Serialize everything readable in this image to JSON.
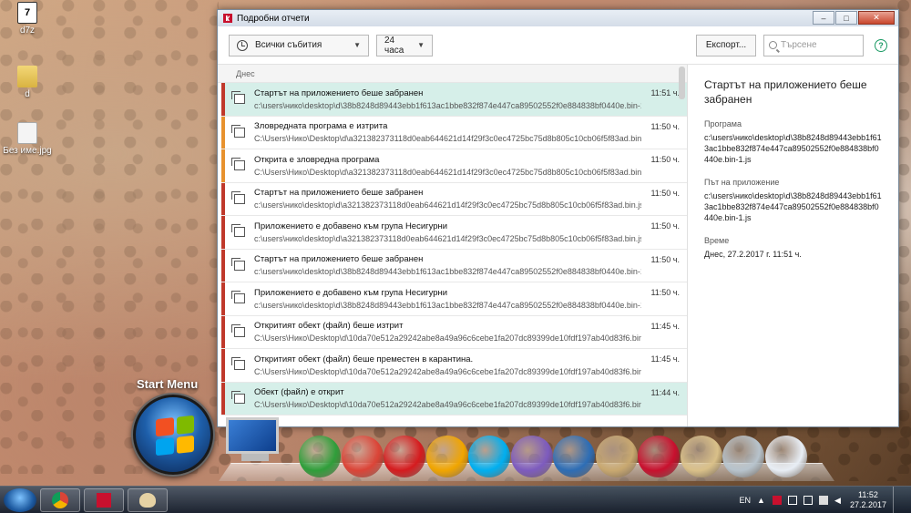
{
  "desktop": {
    "icons": [
      {
        "label": "d7z",
        "icon": "7z-archive-icon"
      },
      {
        "label": "d",
        "icon": "folder-icon"
      },
      {
        "label": "Без име.jpg",
        "icon": "image-file-icon"
      }
    ]
  },
  "window": {
    "title": "Подробни отчети",
    "controls": {
      "minimize": "‒",
      "maximize": "□",
      "close": "✕"
    }
  },
  "toolbar": {
    "events_filter": "Всички събития",
    "time_filter": "24 часа",
    "export_label": "Експорт...",
    "search_placeholder": "Търсене",
    "help_label": "?"
  },
  "list": {
    "group_label": "Днес",
    "rows": [
      {
        "title": "Стартът на приложението беше забранен",
        "path": "c:\\users\\нико\\desktop\\d\\38b8248d89443ebb1f613ac1bbe832f874e447ca89502552f0e884838bf0440e.bin-1.js",
        "time": "11:51 ч.",
        "severity_color": "#c0392b",
        "selected": true
      },
      {
        "title": "Зловредната програма е изтрита",
        "path": "C:\\Users\\Нико\\Desktop\\d\\a321382373118d0eab644621d14f29f3c0ec4725bc75d8b805c10cb06f5f83ad.bin.js",
        "time": "11:50 ч.",
        "severity_color": "#e8922e",
        "selected": false
      },
      {
        "title": "Открита е зловредна програма",
        "path": "C:\\Users\\Нико\\Desktop\\d\\a321382373118d0eab644621d14f29f3c0ec4725bc75d8b805c10cb06f5f83ad.bin.js",
        "time": "11:50 ч.",
        "severity_color": "#e8922e",
        "selected": false
      },
      {
        "title": "Стартът на приложението беше забранен",
        "path": "c:\\users\\нико\\desktop\\d\\a321382373118d0eab644621d14f29f3c0ec4725bc75d8b805c10cb06f5f83ad.bin.js",
        "time": "11:50 ч.",
        "severity_color": "#c0392b",
        "selected": false
      },
      {
        "title": "Приложението е добавено към група Несигурни",
        "path": "c:\\users\\нико\\desktop\\d\\a321382373118d0eab644621d14f29f3c0ec4725bc75d8b805c10cb06f5f83ad.bin.js",
        "time": "11:50 ч.",
        "severity_color": "#c0392b",
        "selected": false
      },
      {
        "title": "Стартът на приложението беше забранен",
        "path": "c:\\users\\нико\\desktop\\d\\38b8248d89443ebb1f613ac1bbe832f874e447ca89502552f0e884838bf0440e.bin-1.js",
        "time": "11:50 ч.",
        "severity_color": "#c0392b",
        "selected": false
      },
      {
        "title": "Приложението е добавено към група Несигурни",
        "path": "c:\\users\\нико\\desktop\\d\\38b8248d89443ebb1f613ac1bbe832f874e447ca89502552f0e884838bf0440e.bin-1.js",
        "time": "11:50 ч.",
        "severity_color": "#c0392b",
        "selected": false
      },
      {
        "title": "Откритият обект (файл) беше изтрит",
        "path": "C:\\Users\\Нико\\Desktop\\d\\10da70e512a29242abe8a49a96c6cebe1fa207dc89399de10fdf197ab40d83f6.bin.js",
        "time": "11:45 ч.",
        "severity_color": "#c0392b",
        "selected": false
      },
      {
        "title": "Откритият обект (файл) беше преместен в карантина.",
        "path": "C:\\Users\\Нико\\Desktop\\d\\10da70e512a29242abe8a49a96c6cebe1fa207dc89399de10fdf197ab40d83f6.bin.js",
        "time": "11:45 ч.",
        "severity_color": "#c0392b",
        "selected": false
      },
      {
        "title": "Обект (файл) е открит",
        "path": "C:\\Users\\Нико\\Desktop\\d\\10da70e512a29242abe8a49a96c6cebe1fa207dc89399de10fdf197ab40d83f6.bin.js",
        "time": "11:44 ч.",
        "severity_color": "#c0392b",
        "selected": true
      }
    ]
  },
  "details": {
    "title": "Стартът на приложението беше забранен",
    "program_label": "Програма",
    "program_value": "c:\\users\\нико\\desktop\\d\\38b8248d89443ebb1f613ac1bbe832f874e447ca89502552f0e884838bf0440e.bin-1.js",
    "path_label": "Път на приложение",
    "path_value": "c:\\users\\нико\\desktop\\d\\38b8248d89443ebb1f613ac1bbe832f874e447ca89502552f0e884838bf0440e.bin-1.js",
    "time_label": "Време",
    "time_value": "Днес, 27.2.2017 г. 11:51 ч."
  },
  "dock": {
    "start_menu_label": "Start Menu",
    "items": [
      {
        "icon": "recycle-icon",
        "color": "#2f9e3a"
      },
      {
        "icon": "chrome-icon",
        "color": "#db4437"
      },
      {
        "icon": "opera-icon",
        "color": "#d51b1e"
      },
      {
        "icon": "media-player-icon",
        "color": "#f0a500"
      },
      {
        "icon": "skype-icon",
        "color": "#00aff0"
      },
      {
        "icon": "viber-icon",
        "color": "#7d5bbe"
      },
      {
        "icon": "virtualbox-icon",
        "color": "#2d6db5"
      },
      {
        "icon": "tools-icon",
        "color": "#c8a870"
      },
      {
        "icon": "kaspersky-icon",
        "color": "#c8102e"
      },
      {
        "icon": "paint-icon",
        "color": "#d9c089"
      },
      {
        "icon": "recycle-bin-icon",
        "color": "#b7c3cc"
      },
      {
        "icon": "clock-icon",
        "color": "#e8eef5"
      }
    ]
  },
  "taskbar": {
    "language": "EN",
    "time": "11:52",
    "date": "27.2.2017"
  }
}
